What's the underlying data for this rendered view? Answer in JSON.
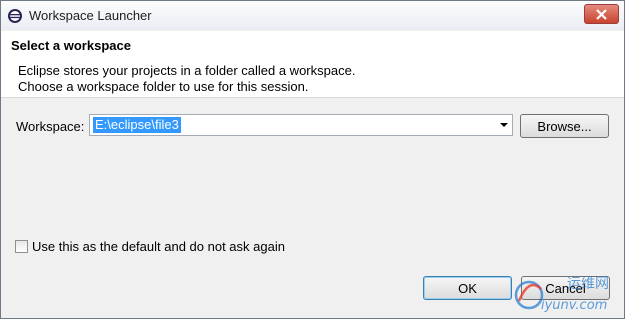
{
  "window": {
    "title": "Workspace Launcher",
    "icon": "eclipse-icon"
  },
  "header": {
    "title": "Select a workspace",
    "description_lines": [
      "Eclipse stores your projects in a folder called a workspace.",
      "Choose a workspace folder to use for this session."
    ]
  },
  "workspace": {
    "label": "Workspace:",
    "value": "E:\\eclipse\\file3",
    "browse_label": "Browse..."
  },
  "default_checkbox": {
    "label": "Use this as the default and do not ask again",
    "checked": false
  },
  "buttons": {
    "ok_label": "OK",
    "cancel_label": "Cancel"
  },
  "watermark": {
    "text_top": "运维网",
    "text_bottom": "iyunv.com"
  },
  "colors": {
    "selection": "#3399ff",
    "close_button": "#c9432d",
    "header_bg": "#ffffff",
    "dialog_bg": "#f0f0f0"
  }
}
